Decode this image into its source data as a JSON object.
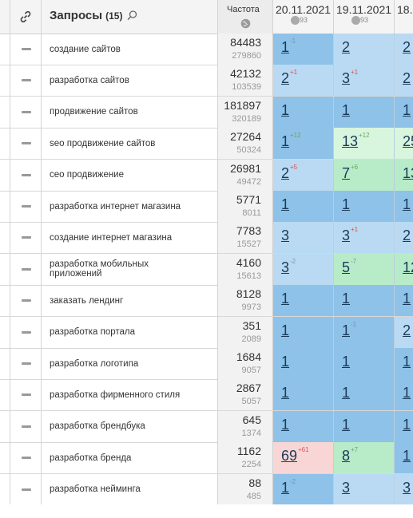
{
  "header": {
    "queries_title": "Запросы",
    "queries_count": "(15)",
    "freq_title": "Частота",
    "dates": [
      {
        "date": "20.11.2021",
        "badge": "93"
      },
      {
        "date": "19.11.2021",
        "badge": "93"
      },
      {
        "date": "18.",
        "badge": ""
      }
    ]
  },
  "colors": {
    "blue": "#8ec2e8",
    "light_blue": "#b9daf2",
    "green": "#b8ebc8",
    "light_green": "#d8f5dd",
    "pink": "#f9d6d6",
    "delta_up": "#6aa56a",
    "delta_down": "#d45555"
  },
  "rows": [
    {
      "name": "создание сайтов",
      "freq": "84483",
      "freq_sub": "279860",
      "pos": [
        {
          "v": "1",
          "d": "-1",
          "bg": "blue"
        },
        {
          "v": "2",
          "d": "",
          "bg": "light_blue"
        },
        {
          "v": "2",
          "d": "",
          "bg": "light_blue"
        }
      ]
    },
    {
      "name": "разработка сайтов",
      "freq": "42132",
      "freq_sub": "103539",
      "pos": [
        {
          "v": "2",
          "d": "+1",
          "bg": "light_blue"
        },
        {
          "v": "3",
          "d": "+1",
          "bg": "light_blue"
        },
        {
          "v": "2",
          "d": "",
          "bg": "light_blue"
        }
      ]
    },
    {
      "name": "продвижение сайтов",
      "freq": "181897",
      "freq_sub": "320189",
      "pos": [
        {
          "v": "1",
          "d": "",
          "bg": "blue"
        },
        {
          "v": "1",
          "d": "",
          "bg": "blue"
        },
        {
          "v": "1",
          "d": "",
          "bg": "blue"
        }
      ]
    },
    {
      "name": "seo продвижение сайтов",
      "freq": "27264",
      "freq_sub": "50324",
      "pos": [
        {
          "v": "1",
          "d": "+12",
          "bg": "blue"
        },
        {
          "v": "13",
          "d": "+12",
          "bg": "light_green"
        },
        {
          "v": "25",
          "d": "",
          "bg": "light_green"
        }
      ]
    },
    {
      "name": "сео продвижение",
      "freq": "26981",
      "freq_sub": "49472",
      "pos": [
        {
          "v": "2",
          "d": "+5",
          "bg": "light_blue"
        },
        {
          "v": "7",
          "d": "+6",
          "bg": "green"
        },
        {
          "v": "13",
          "d": "",
          "bg": "green"
        }
      ]
    },
    {
      "name": "разработка интернет магазина",
      "freq": "5771",
      "freq_sub": "8011",
      "pos": [
        {
          "v": "1",
          "d": "",
          "bg": "blue"
        },
        {
          "v": "1",
          "d": "",
          "bg": "blue"
        },
        {
          "v": "1",
          "d": "",
          "bg": "blue"
        }
      ]
    },
    {
      "name": "создание интернет магазина",
      "freq": "7783",
      "freq_sub": "15527",
      "pos": [
        {
          "v": "3",
          "d": "",
          "bg": "light_blue"
        },
        {
          "v": "3",
          "d": "+1",
          "bg": "light_blue"
        },
        {
          "v": "2",
          "d": "",
          "bg": "light_blue"
        }
      ]
    },
    {
      "name": "разработка мобильных приложений",
      "freq": "4160",
      "freq_sub": "15613",
      "pos": [
        {
          "v": "3",
          "d": "-2",
          "bg": "light_blue"
        },
        {
          "v": "5",
          "d": "-7",
          "bg": "green"
        },
        {
          "v": "12",
          "d": "",
          "bg": "green"
        }
      ]
    },
    {
      "name": "заказать лендинг",
      "freq": "8128",
      "freq_sub": "9973",
      "pos": [
        {
          "v": "1",
          "d": "",
          "bg": "blue"
        },
        {
          "v": "1",
          "d": "",
          "bg": "blue"
        },
        {
          "v": "1",
          "d": "",
          "bg": "blue"
        }
      ]
    },
    {
      "name": "разработка портала",
      "freq": "351",
      "freq_sub": "2089",
      "pos": [
        {
          "v": "1",
          "d": "",
          "bg": "blue"
        },
        {
          "v": "1",
          "d": "-1",
          "bg": "blue"
        },
        {
          "v": "2",
          "d": "",
          "bg": "light_blue"
        }
      ]
    },
    {
      "name": "разработка логотипа",
      "freq": "1684",
      "freq_sub": "9057",
      "pos": [
        {
          "v": "1",
          "d": "",
          "bg": "blue"
        },
        {
          "v": "1",
          "d": "",
          "bg": "blue"
        },
        {
          "v": "1",
          "d": "",
          "bg": "blue"
        }
      ]
    },
    {
      "name": "разработка фирменного стиля",
      "freq": "2867",
      "freq_sub": "5057",
      "pos": [
        {
          "v": "1",
          "d": "",
          "bg": "blue"
        },
        {
          "v": "1",
          "d": "",
          "bg": "blue"
        },
        {
          "v": "1",
          "d": "",
          "bg": "blue"
        }
      ]
    },
    {
      "name": "разработка брендбука",
      "freq": "645",
      "freq_sub": "1374",
      "pos": [
        {
          "v": "1",
          "d": "",
          "bg": "blue"
        },
        {
          "v": "1",
          "d": "",
          "bg": "blue"
        },
        {
          "v": "1",
          "d": "",
          "bg": "blue"
        }
      ]
    },
    {
      "name": "разработка бренда",
      "freq": "1162",
      "freq_sub": "2254",
      "pos": [
        {
          "v": "69",
          "d": "+61",
          "bg": "pink"
        },
        {
          "v": "8",
          "d": "+7",
          "bg": "green"
        },
        {
          "v": "1",
          "d": "",
          "bg": "blue"
        }
      ]
    },
    {
      "name": "разработка нейминга",
      "freq": "88",
      "freq_sub": "485",
      "pos": [
        {
          "v": "1",
          "d": "-2",
          "bg": "blue"
        },
        {
          "v": "3",
          "d": "",
          "bg": "light_blue"
        },
        {
          "v": "3",
          "d": "",
          "bg": "light_blue"
        }
      ]
    }
  ]
}
